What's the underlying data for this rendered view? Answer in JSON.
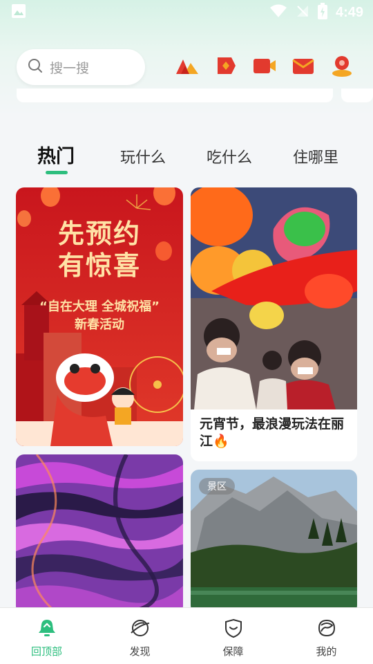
{
  "status_bar": {
    "time": "4:49"
  },
  "search": {
    "placeholder": "搜一搜"
  },
  "tabs": [
    {
      "label": "热门"
    },
    {
      "label": "玩什么"
    },
    {
      "label": "吃什么"
    },
    {
      "label": "住哪里"
    }
  ],
  "feed": {
    "card1": {
      "headline1": "先预约",
      "headline2": "有惊喜",
      "slogan": "“自在大理 全城祝福”",
      "subtitle": "新春活动"
    },
    "card2": {
      "title": "元宵节，最浪漫玩法在丽江🔥"
    },
    "card4": {
      "badge": "景区"
    }
  },
  "bottom_nav": [
    {
      "label": "回顶部",
      "icon": "bell-up-icon",
      "active": true
    },
    {
      "label": "发现",
      "icon": "planet-icon",
      "active": false
    },
    {
      "label": "保障",
      "icon": "shield-icon",
      "active": false
    },
    {
      "label": "我的",
      "icon": "profile-icon",
      "active": false
    }
  ],
  "colors": {
    "accent": "#2dbe7e",
    "header_bg": "#d6f2e6",
    "page_bg": "#f4f6f8"
  }
}
